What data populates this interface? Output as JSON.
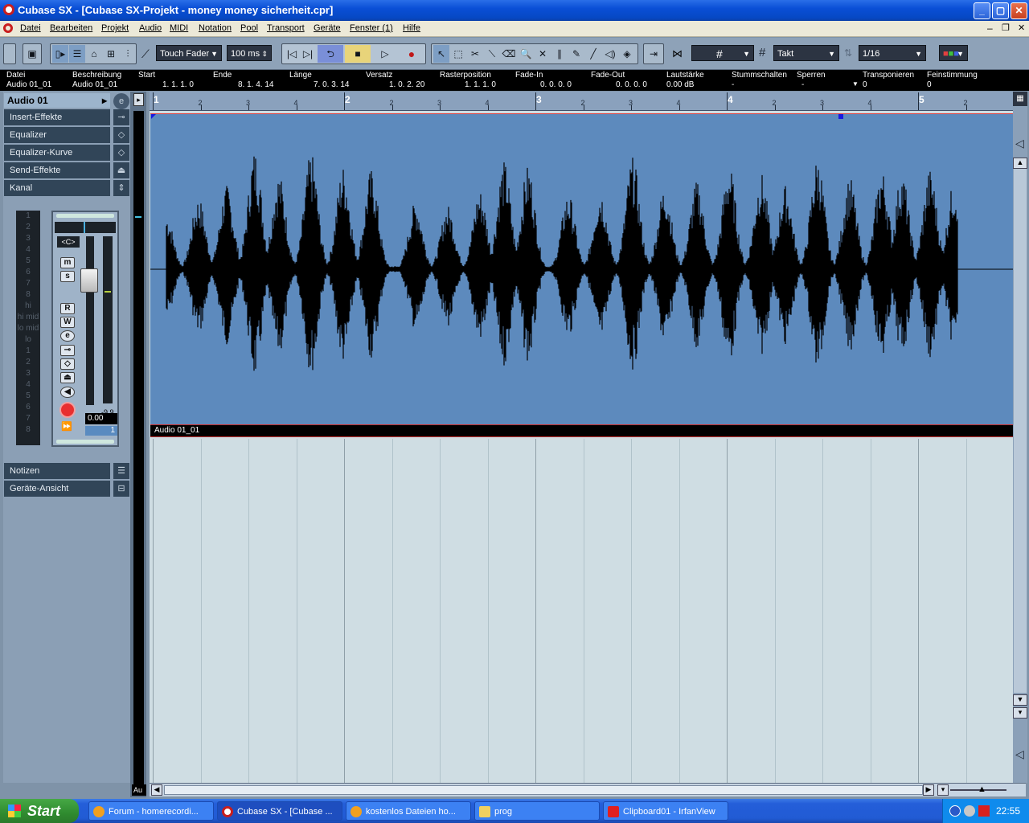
{
  "window": {
    "title": "Cubase SX - [Cubase SX-Projekt - money money sicherheit.cpr]"
  },
  "menu": [
    "Datei",
    "Bearbeiten",
    "Projekt",
    "Audio",
    "MIDI",
    "Notation",
    "Pool",
    "Transport",
    "Geräte",
    "Fenster (1)",
    "Hilfe"
  ],
  "toolbar": {
    "automation_mode": "Touch Fader",
    "time": "100 ms",
    "grid_type": "Takt",
    "quantize": "1/16"
  },
  "infoline": {
    "labels": [
      "Datei",
      "Beschreibung",
      "Start",
      "Ende",
      "Länge",
      "Versatz",
      "Rasterposition",
      "Fade-In",
      "Fade-Out",
      "Lautstärke",
      "Stummschalten",
      "Sperren",
      "Transponieren",
      "Feinstimmung"
    ],
    "values": [
      "Audio 01_01",
      "Audio 01_01",
      "1. 1. 1.   0",
      "8. 1. 4. 14",
      "7. 0. 3. 14",
      "1. 0. 2. 20",
      "1. 1. 1.   0",
      "0. 0. 0.   0",
      "0. 0. 0.   0",
      "0.00 dB",
      "-",
      "-",
      "0",
      "0"
    ]
  },
  "inspector": {
    "track_name": "Audio 01",
    "sections": [
      "Insert-Effekte",
      "Equalizer",
      "Equalizer-Kurve",
      "Send-Effekte",
      "Kanal"
    ],
    "bottom_sections": [
      "Notizen",
      "Geräte-Ansicht"
    ],
    "meter_scale": [
      "1",
      "2",
      "3",
      "4",
      "5",
      "6",
      "7",
      "8",
      "hi",
      "hi mid",
      "lo mid",
      "lo",
      "1",
      "2",
      "3",
      "4",
      "5",
      "6",
      "7",
      "8"
    ],
    "pan": "<C>",
    "volume": "0.00",
    "peak": "-9.9",
    "channel_number": "1",
    "buttons": {
      "mute": "m",
      "solo": "s",
      "read": "R",
      "write": "W",
      "edit": "e"
    }
  },
  "ruler": {
    "bars": [
      "1",
      "2",
      "3",
      "4",
      "5"
    ],
    "beats": [
      "2",
      "3",
      "4"
    ]
  },
  "event": {
    "name": "Audio 01_01",
    "track_label": "Au"
  },
  "taskbar": {
    "start": "Start",
    "tasks": [
      "Forum - homerecordi...",
      "Cubase SX - [Cubase ...",
      "kostenlos Dateien ho...",
      "prog",
      "Clipboard01 - IrfanView"
    ],
    "clock": "22:55"
  },
  "colors": {
    "event_bg": "#5d8abd",
    "waveform": "#000000",
    "titlebar": "#0a4fd6"
  }
}
